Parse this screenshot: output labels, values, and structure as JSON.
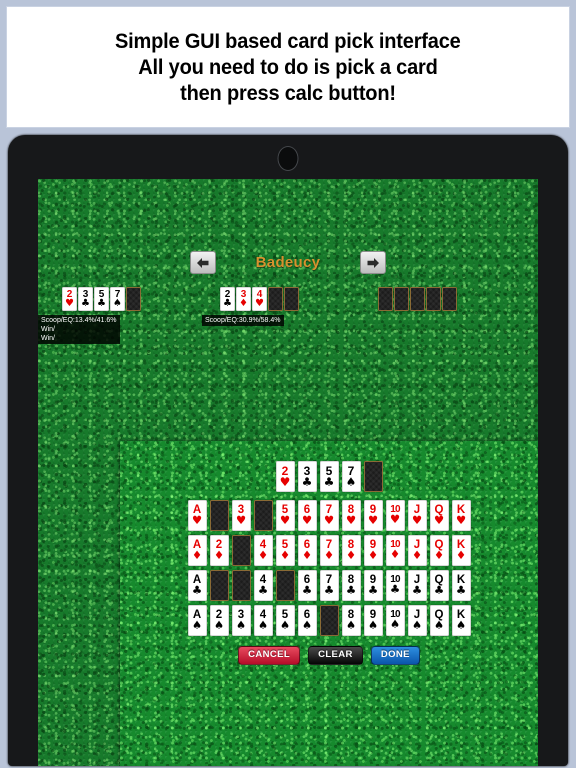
{
  "banner": {
    "lines": [
      "Simple GUI based card pick interface",
      "All you need to do is pick a card",
      "then press calc button!"
    ]
  },
  "colors": {
    "felt_green": "#177a2b",
    "title_orange": "#d7922f",
    "card_red": "#e60000",
    "card_black": "#000000",
    "cancel_red": "#b50d28",
    "clear_black": "#050505",
    "done_blue": "#0a55aa",
    "bezel_black": "#17181a",
    "page_border_blue": "#b9c4d8"
  },
  "tablet": {
    "camera_label": "front-camera"
  },
  "topnav": {
    "prev_icon": "arrow-left-icon",
    "next_icon": "arrow-right-icon",
    "title": "Badeucy"
  },
  "hands": [
    {
      "id": "hand-1",
      "cards": [
        {
          "rank": "2",
          "suit": "♥",
          "color": "red",
          "facedown": false
        },
        {
          "rank": "3",
          "suit": "♣",
          "color": "black",
          "facedown": false
        },
        {
          "rank": "5",
          "suit": "♣",
          "color": "black",
          "facedown": false
        },
        {
          "rank": "7",
          "suit": "♠",
          "color": "black",
          "facedown": false
        },
        {
          "rank": "",
          "suit": "",
          "color": "black",
          "facedown": true
        }
      ],
      "stats": [
        "Scoop/EQ:13.4%/41.6%",
        "Win/",
        "Win/"
      ]
    },
    {
      "id": "hand-2",
      "cards": [
        {
          "rank": "2",
          "suit": "♣",
          "color": "black",
          "facedown": false
        },
        {
          "rank": "3",
          "suit": "♦",
          "color": "red",
          "facedown": false
        },
        {
          "rank": "4",
          "suit": "♥",
          "color": "red",
          "facedown": false
        },
        {
          "rank": "",
          "suit": "",
          "color": "black",
          "facedown": true
        },
        {
          "rank": "",
          "suit": "",
          "color": "black",
          "facedown": true
        }
      ],
      "stats": [
        "Scoop/EQ:30.9%/58.4%"
      ]
    },
    {
      "id": "hand-3",
      "cards": [
        {
          "rank": "",
          "suit": "",
          "color": "black",
          "facedown": true
        },
        {
          "rank": "",
          "suit": "",
          "color": "black",
          "facedown": true
        },
        {
          "rank": "",
          "suit": "",
          "color": "black",
          "facedown": true
        },
        {
          "rank": "",
          "suit": "",
          "color": "black",
          "facedown": true
        },
        {
          "rank": "",
          "suit": "",
          "color": "black",
          "facedown": true
        }
      ],
      "stats": []
    }
  ],
  "picker": {
    "selected_hand": [
      {
        "rank": "2",
        "suit": "♥",
        "color": "red",
        "facedown": false
      },
      {
        "rank": "3",
        "suit": "♣",
        "color": "black",
        "facedown": false
      },
      {
        "rank": "5",
        "suit": "♣",
        "color": "black",
        "facedown": false
      },
      {
        "rank": "7",
        "suit": "♠",
        "color": "black",
        "facedown": false
      },
      {
        "rank": "",
        "suit": "",
        "color": "black",
        "facedown": true
      }
    ],
    "ranks": [
      "A",
      "2",
      "3",
      "4",
      "5",
      "6",
      "7",
      "8",
      "9",
      "10",
      "J",
      "Q",
      "K"
    ],
    "rows": [
      {
        "suit": "♥",
        "suit_name": "hearts",
        "color": "red",
        "cards": [
          {
            "rank": "A",
            "used": false
          },
          {
            "rank": "2",
            "used": true
          },
          {
            "rank": "3",
            "used": false
          },
          {
            "rank": "4",
            "used": true
          },
          {
            "rank": "5",
            "used": false
          },
          {
            "rank": "6",
            "used": false
          },
          {
            "rank": "7",
            "used": false
          },
          {
            "rank": "8",
            "used": false
          },
          {
            "rank": "9",
            "used": false
          },
          {
            "rank": "10",
            "used": false
          },
          {
            "rank": "J",
            "used": false
          },
          {
            "rank": "Q",
            "used": false
          },
          {
            "rank": "K",
            "used": false
          }
        ]
      },
      {
        "suit": "♦",
        "suit_name": "diamonds",
        "color": "red",
        "cards": [
          {
            "rank": "A",
            "used": false
          },
          {
            "rank": "2",
            "used": false
          },
          {
            "rank": "3",
            "used": true
          },
          {
            "rank": "4",
            "used": false
          },
          {
            "rank": "5",
            "used": false
          },
          {
            "rank": "6",
            "used": false
          },
          {
            "rank": "7",
            "used": false
          },
          {
            "rank": "8",
            "used": false
          },
          {
            "rank": "9",
            "used": false
          },
          {
            "rank": "10",
            "used": false
          },
          {
            "rank": "J",
            "used": false
          },
          {
            "rank": "Q",
            "used": false
          },
          {
            "rank": "K",
            "used": false
          }
        ]
      },
      {
        "suit": "♣",
        "suit_name": "clubs",
        "color": "black",
        "cards": [
          {
            "rank": "A",
            "used": false
          },
          {
            "rank": "2",
            "used": true
          },
          {
            "rank": "3",
            "used": true
          },
          {
            "rank": "4",
            "used": false
          },
          {
            "rank": "5",
            "used": true
          },
          {
            "rank": "6",
            "used": false
          },
          {
            "rank": "7",
            "used": false
          },
          {
            "rank": "8",
            "used": false
          },
          {
            "rank": "9",
            "used": false
          },
          {
            "rank": "10",
            "used": false
          },
          {
            "rank": "J",
            "used": false
          },
          {
            "rank": "Q",
            "used": false
          },
          {
            "rank": "K",
            "used": false
          }
        ]
      },
      {
        "suit": "♠",
        "suit_name": "spades",
        "color": "black",
        "cards": [
          {
            "rank": "A",
            "used": false
          },
          {
            "rank": "2",
            "used": false
          },
          {
            "rank": "3",
            "used": false
          },
          {
            "rank": "4",
            "used": false
          },
          {
            "rank": "5",
            "used": false
          },
          {
            "rank": "6",
            "used": false
          },
          {
            "rank": "7",
            "used": true
          },
          {
            "rank": "8",
            "used": false
          },
          {
            "rank": "9",
            "used": false
          },
          {
            "rank": "10",
            "used": false
          },
          {
            "rank": "J",
            "used": false
          },
          {
            "rank": "Q",
            "used": false
          },
          {
            "rank": "K",
            "used": false
          }
        ]
      }
    ],
    "buttons": [
      {
        "id": "cancel",
        "label": "CANCEL"
      },
      {
        "id": "clear",
        "label": "CLEAR"
      },
      {
        "id": "done",
        "label": "DONE"
      }
    ]
  }
}
